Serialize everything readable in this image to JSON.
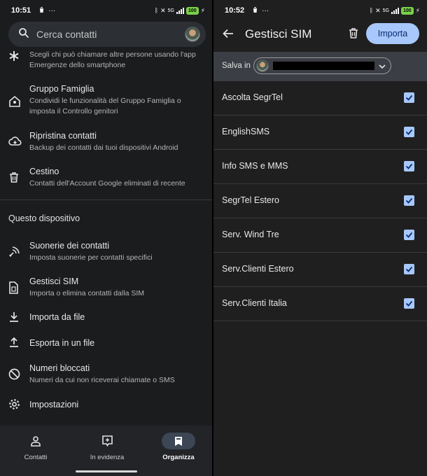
{
  "left": {
    "status": {
      "time": "10:51",
      "battery": "100",
      "network": "5G"
    },
    "search": {
      "placeholder": "Cerca contatti"
    },
    "items": [
      {
        "icon": "asterisk-icon",
        "title": "",
        "sub": "Scegli chi può chiamare altre persone usando l'app Emergenze dello smartphone"
      },
      {
        "icon": "family-home-icon",
        "title": "Gruppo Famiglia",
        "sub": "Condividi le funzionalità del Gruppo Famiglia o imposta il Controllo genitori"
      },
      {
        "icon": "cloud-restore-icon",
        "title": "Ripristina contatti",
        "sub": "Backup dei contatti dai tuoi dispositivi Android"
      },
      {
        "icon": "trash-icon",
        "title": "Cestino",
        "sub": "Contatti dell'Account Google eliminati di recente"
      }
    ],
    "section_title": "Questo dispositivo",
    "device_items": [
      {
        "icon": "ringtone-icon",
        "title": "Suonerie dei contatti",
        "sub": "Imposta suonerie per contatti specifici"
      },
      {
        "icon": "sim-card-icon",
        "title": "Gestisci SIM",
        "sub": "Importa o elimina contatti dalla SIM"
      },
      {
        "icon": "download-icon",
        "title": "Importa da file",
        "sub": ""
      },
      {
        "icon": "upload-icon",
        "title": "Esporta in un file",
        "sub": ""
      },
      {
        "icon": "block-icon",
        "title": "Numeri bloccati",
        "sub": "Numeri da cui non riceverai chiamate o SMS"
      },
      {
        "icon": "gear-icon",
        "title": "Impostazioni",
        "sub": ""
      }
    ],
    "nav": [
      {
        "icon": "person-icon",
        "label": "Contatti",
        "active": false
      },
      {
        "icon": "highlight-icon",
        "label": "In evidenza",
        "active": false
      },
      {
        "icon": "bookmark-icon",
        "label": "Organizza",
        "active": true
      }
    ]
  },
  "right": {
    "status": {
      "time": "10:52",
      "battery": "100",
      "network": "5G"
    },
    "title": "Gestisci SIM",
    "import_label": "Importa",
    "save_label": "Salva in",
    "contacts": [
      {
        "name": "Ascolta SegrTel",
        "checked": true
      },
      {
        "name": "EnglishSMS",
        "checked": true
      },
      {
        "name": "Info SMS e MMS",
        "checked": true
      },
      {
        "name": "SegrTel Estero",
        "checked": true
      },
      {
        "name": "Serv. Wind Tre",
        "checked": true
      },
      {
        "name": "Serv.Clienti Estero",
        "checked": true
      },
      {
        "name": "Serv.Clienti Italia",
        "checked": true
      }
    ]
  },
  "colors": {
    "accent": "#a8c7fa",
    "background": "#1f1f1f",
    "battery": "#7bd14a"
  }
}
